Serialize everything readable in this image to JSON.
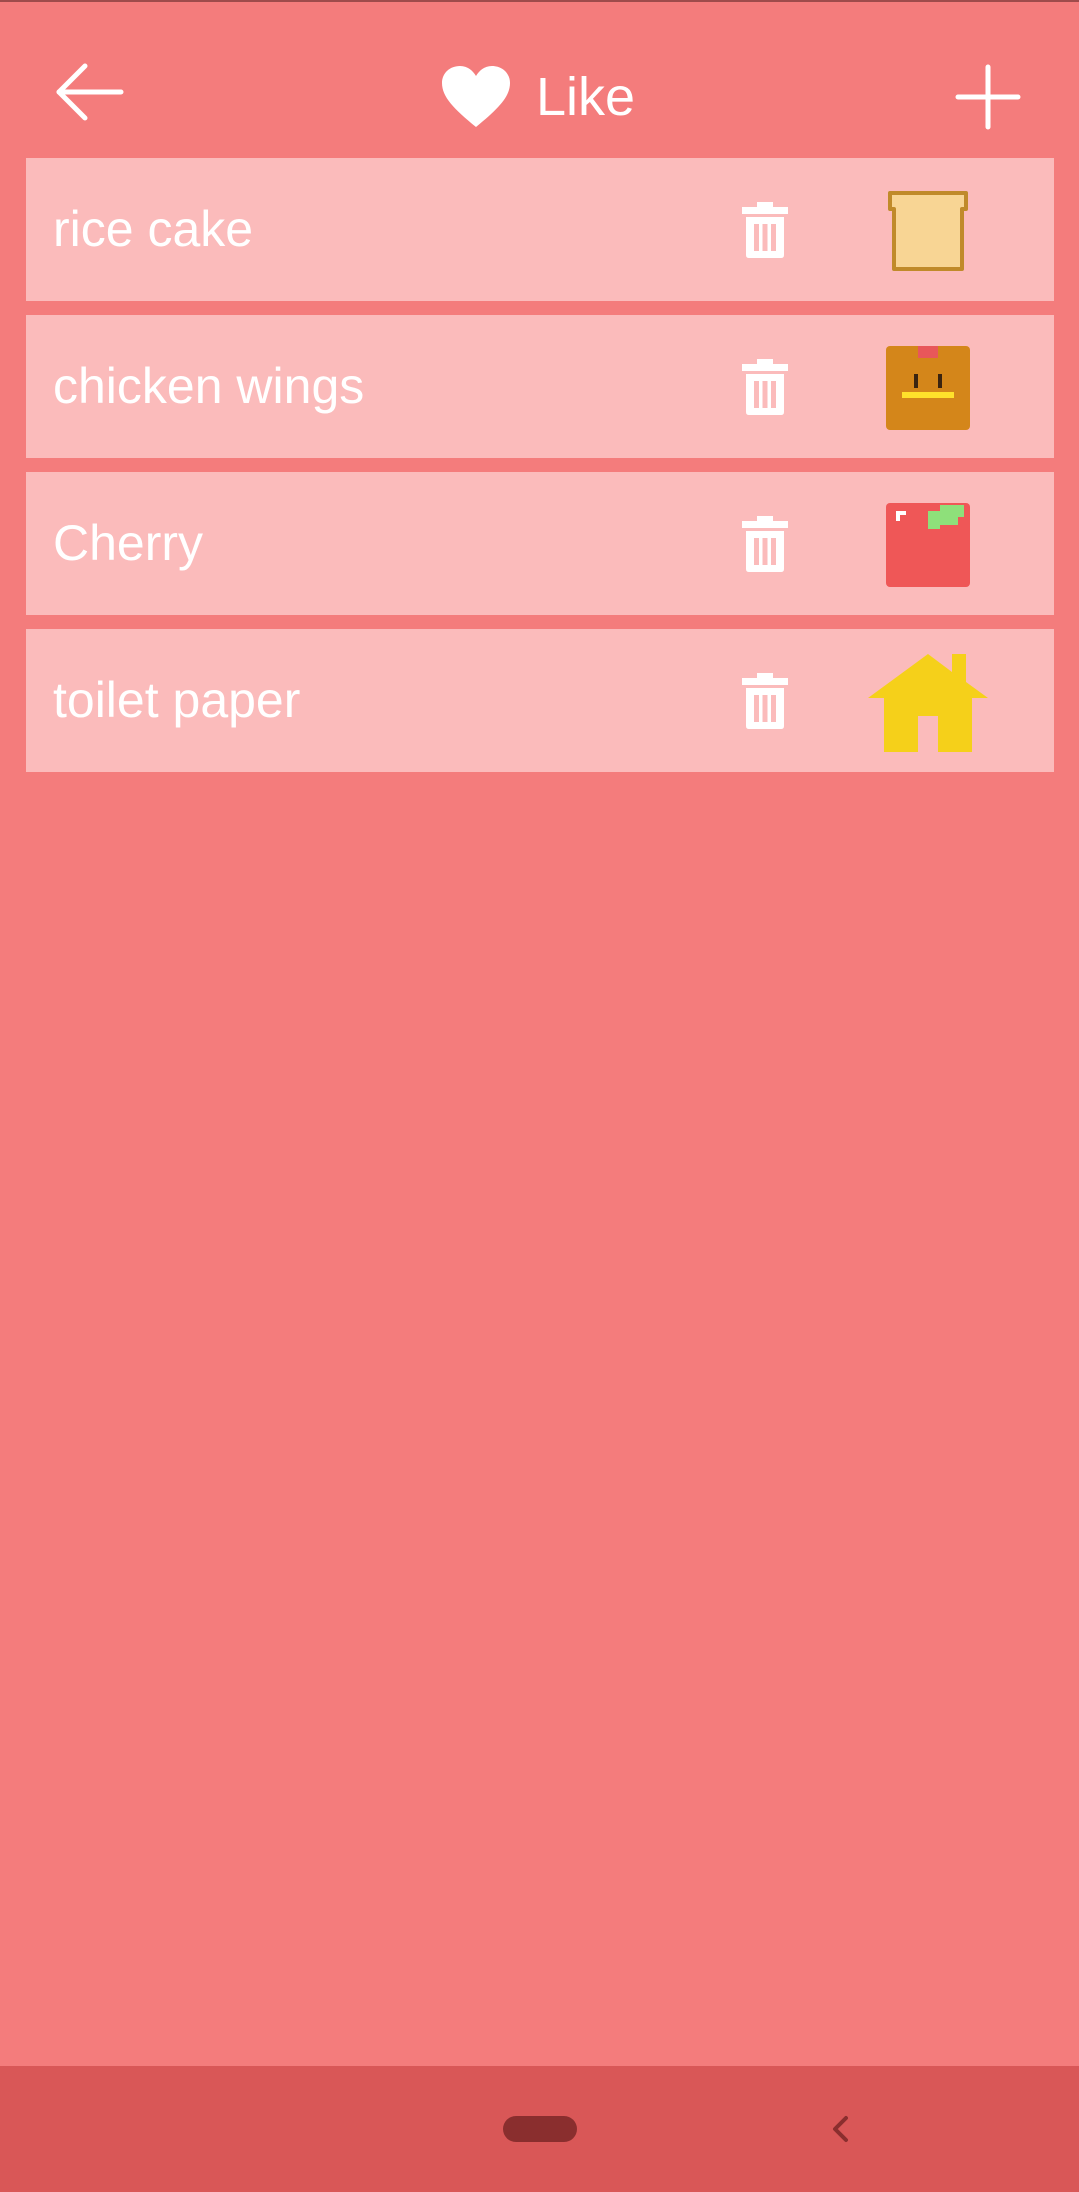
{
  "header": {
    "title": "Like",
    "back_icon": "arrow-left-icon",
    "add_icon": "plus-icon",
    "title_icon": "heart-icon"
  },
  "items": [
    {
      "label": "rice cake",
      "icon": "bread-icon"
    },
    {
      "label": "chicken wings",
      "icon": "chicken-box-icon"
    },
    {
      "label": "Cherry",
      "icon": "apple-icon"
    },
    {
      "label": "toilet paper",
      "icon": "house-icon"
    }
  ],
  "colors": {
    "background": "#F47C7C",
    "row": "#FBBBBB",
    "navbar": "#D95757",
    "text": "#FFFFFF"
  }
}
